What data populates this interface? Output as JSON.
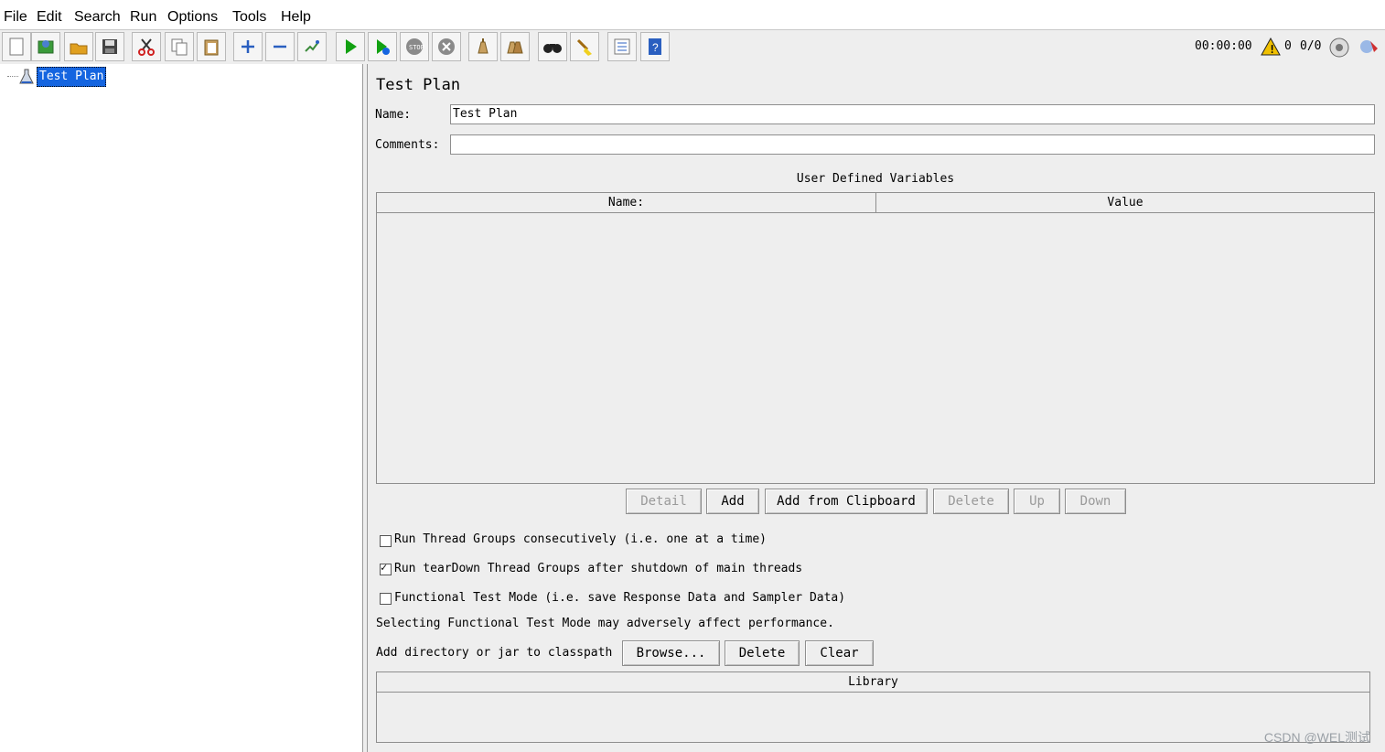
{
  "menu": [
    "File",
    "Edit",
    "Search",
    "Run",
    "Options",
    "Tools",
    "Help"
  ],
  "toolbar": {
    "icons": [
      "new-icon",
      "templates-icon",
      "open-icon",
      "save-icon",
      "cut-icon",
      "copy-icon",
      "paste-icon",
      "expand-icon",
      "collapse-icon",
      "toggle-icon",
      "start-icon",
      "start-no-pauses-icon",
      "stop-icon",
      "shutdown-icon",
      "clear-icon",
      "clear-all-icon",
      "search-icon",
      "reset-search-icon",
      "function-helper-icon",
      "help-icon"
    ],
    "timer": "00:00:00",
    "warning_count": "0",
    "threads": "0/0",
    "colors": {
      "play": "#12a112",
      "stop": "#8a8a8a",
      "accent": "#1565e0"
    }
  },
  "tree": {
    "root_label": "Test Plan"
  },
  "panel": {
    "title": "Test Plan",
    "name_label": "Name:",
    "name_value": "Test Plan",
    "comments_label": "Comments:",
    "comments_value": "",
    "udv_title": "User Defined Variables",
    "udv_columns": [
      "Name:",
      "Value"
    ],
    "buttons": [
      "Detail",
      "Add",
      "Add from Clipboard",
      "Delete",
      "Up",
      "Down"
    ],
    "checkbox1": "Run Thread Groups consecutively (i.e. one at a time)",
    "checkbox1_checked": false,
    "checkbox2": "Run tearDown Thread Groups after shutdown of main threads",
    "checkbox2_checked": true,
    "checkbox3": "Functional Test Mode (i.e. save Response Data and Sampler Data)",
    "checkbox3_checked": false,
    "functional_note": "Selecting Functional Test Mode may adversely affect performance.",
    "classpath_label": "Add directory or jar to classpath",
    "classpath_buttons": [
      "Browse...",
      "Delete",
      "Clear"
    ],
    "library_header": "Library"
  },
  "watermark": "CSDN @WEL测试"
}
